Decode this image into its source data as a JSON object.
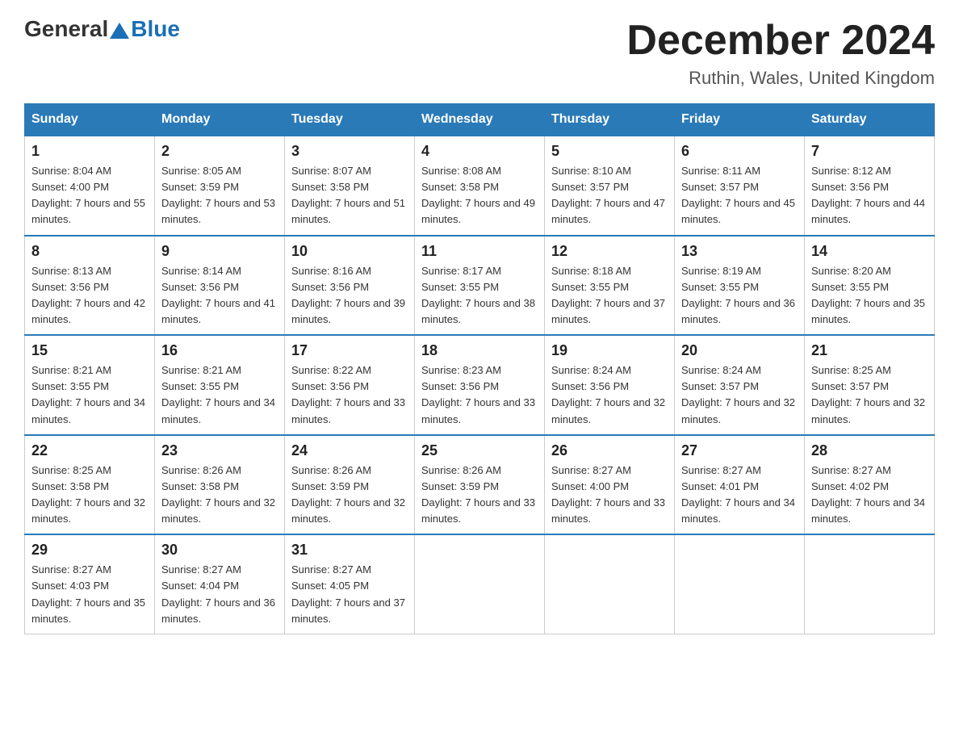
{
  "header": {
    "logo": {
      "general": "General",
      "blue": "Blue"
    },
    "title": "December 2024",
    "location": "Ruthin, Wales, United Kingdom"
  },
  "weekdays": [
    "Sunday",
    "Monday",
    "Tuesday",
    "Wednesday",
    "Thursday",
    "Friday",
    "Saturday"
  ],
  "weeks": [
    [
      {
        "day": "1",
        "sunrise": "8:04 AM",
        "sunset": "4:00 PM",
        "daylight": "7 hours and 55 minutes."
      },
      {
        "day": "2",
        "sunrise": "8:05 AM",
        "sunset": "3:59 PM",
        "daylight": "7 hours and 53 minutes."
      },
      {
        "day": "3",
        "sunrise": "8:07 AM",
        "sunset": "3:58 PM",
        "daylight": "7 hours and 51 minutes."
      },
      {
        "day": "4",
        "sunrise": "8:08 AM",
        "sunset": "3:58 PM",
        "daylight": "7 hours and 49 minutes."
      },
      {
        "day": "5",
        "sunrise": "8:10 AM",
        "sunset": "3:57 PM",
        "daylight": "7 hours and 47 minutes."
      },
      {
        "day": "6",
        "sunrise": "8:11 AM",
        "sunset": "3:57 PM",
        "daylight": "7 hours and 45 minutes."
      },
      {
        "day": "7",
        "sunrise": "8:12 AM",
        "sunset": "3:56 PM",
        "daylight": "7 hours and 44 minutes."
      }
    ],
    [
      {
        "day": "8",
        "sunrise": "8:13 AM",
        "sunset": "3:56 PM",
        "daylight": "7 hours and 42 minutes."
      },
      {
        "day": "9",
        "sunrise": "8:14 AM",
        "sunset": "3:56 PM",
        "daylight": "7 hours and 41 minutes."
      },
      {
        "day": "10",
        "sunrise": "8:16 AM",
        "sunset": "3:56 PM",
        "daylight": "7 hours and 39 minutes."
      },
      {
        "day": "11",
        "sunrise": "8:17 AM",
        "sunset": "3:55 PM",
        "daylight": "7 hours and 38 minutes."
      },
      {
        "day": "12",
        "sunrise": "8:18 AM",
        "sunset": "3:55 PM",
        "daylight": "7 hours and 37 minutes."
      },
      {
        "day": "13",
        "sunrise": "8:19 AM",
        "sunset": "3:55 PM",
        "daylight": "7 hours and 36 minutes."
      },
      {
        "day": "14",
        "sunrise": "8:20 AM",
        "sunset": "3:55 PM",
        "daylight": "7 hours and 35 minutes."
      }
    ],
    [
      {
        "day": "15",
        "sunrise": "8:21 AM",
        "sunset": "3:55 PM",
        "daylight": "7 hours and 34 minutes."
      },
      {
        "day": "16",
        "sunrise": "8:21 AM",
        "sunset": "3:55 PM",
        "daylight": "7 hours and 34 minutes."
      },
      {
        "day": "17",
        "sunrise": "8:22 AM",
        "sunset": "3:56 PM",
        "daylight": "7 hours and 33 minutes."
      },
      {
        "day": "18",
        "sunrise": "8:23 AM",
        "sunset": "3:56 PM",
        "daylight": "7 hours and 33 minutes."
      },
      {
        "day": "19",
        "sunrise": "8:24 AM",
        "sunset": "3:56 PM",
        "daylight": "7 hours and 32 minutes."
      },
      {
        "day": "20",
        "sunrise": "8:24 AM",
        "sunset": "3:57 PM",
        "daylight": "7 hours and 32 minutes."
      },
      {
        "day": "21",
        "sunrise": "8:25 AM",
        "sunset": "3:57 PM",
        "daylight": "7 hours and 32 minutes."
      }
    ],
    [
      {
        "day": "22",
        "sunrise": "8:25 AM",
        "sunset": "3:58 PM",
        "daylight": "7 hours and 32 minutes."
      },
      {
        "day": "23",
        "sunrise": "8:26 AM",
        "sunset": "3:58 PM",
        "daylight": "7 hours and 32 minutes."
      },
      {
        "day": "24",
        "sunrise": "8:26 AM",
        "sunset": "3:59 PM",
        "daylight": "7 hours and 32 minutes."
      },
      {
        "day": "25",
        "sunrise": "8:26 AM",
        "sunset": "3:59 PM",
        "daylight": "7 hours and 33 minutes."
      },
      {
        "day": "26",
        "sunrise": "8:27 AM",
        "sunset": "4:00 PM",
        "daylight": "7 hours and 33 minutes."
      },
      {
        "day": "27",
        "sunrise": "8:27 AM",
        "sunset": "4:01 PM",
        "daylight": "7 hours and 34 minutes."
      },
      {
        "day": "28",
        "sunrise": "8:27 AM",
        "sunset": "4:02 PM",
        "daylight": "7 hours and 34 minutes."
      }
    ],
    [
      {
        "day": "29",
        "sunrise": "8:27 AM",
        "sunset": "4:03 PM",
        "daylight": "7 hours and 35 minutes."
      },
      {
        "day": "30",
        "sunrise": "8:27 AM",
        "sunset": "4:04 PM",
        "daylight": "7 hours and 36 minutes."
      },
      {
        "day": "31",
        "sunrise": "8:27 AM",
        "sunset": "4:05 PM",
        "daylight": "7 hours and 37 minutes."
      },
      null,
      null,
      null,
      null
    ]
  ]
}
